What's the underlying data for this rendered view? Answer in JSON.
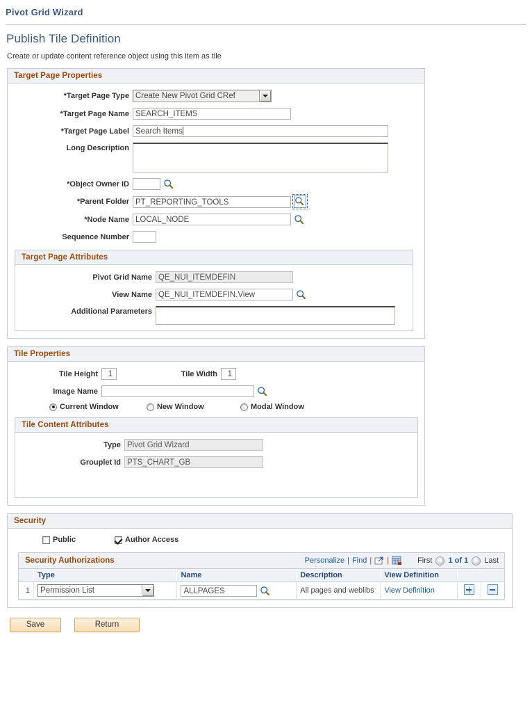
{
  "wizard": {
    "title": "Pivot Grid Wizard"
  },
  "page": {
    "title": "Publish Tile Definition",
    "subtitle": "Create or update content reference object using this item as tile"
  },
  "target_page_properties": {
    "header": "Target Page Properties",
    "fields": {
      "target_page_type": {
        "label": "*Target Page Type",
        "value": "Create New Pivot Grid CRef",
        "icon": "chevron-down-icon"
      },
      "target_page_name": {
        "label": "*Target Page Name",
        "value": "SEARCH_ITEMS"
      },
      "target_page_label": {
        "label": "*Target Page Label",
        "value": "Search Items"
      },
      "long_description": {
        "label": "Long Description",
        "value": ""
      },
      "object_owner_id": {
        "label": "*Object Owner ID",
        "value": "",
        "icon": "lookup-magnifier-icon"
      },
      "parent_folder": {
        "label": "*Parent Folder",
        "value": "PT_REPORTING_TOOLS",
        "icon": "lookup-magnifier-icon"
      },
      "node_name": {
        "label": "*Node Name",
        "value": "LOCAL_NODE",
        "icon": "lookup-magnifier-icon"
      },
      "sequence_number": {
        "label": "Sequence Number",
        "value": ""
      }
    }
  },
  "target_page_attributes": {
    "header": "Target Page Attributes",
    "fields": {
      "pivot_grid_name": {
        "label": "Pivot Grid Name",
        "value": "QE_NUI_ITEMDEFIN"
      },
      "view_name": {
        "label": "View Name",
        "value": "QE_NUI_ITEMDEFIN.View",
        "icon": "lookup-magnifier-icon"
      },
      "additional_parameters": {
        "label": "Additional Parameters",
        "value": ""
      }
    }
  },
  "tile_properties": {
    "header": "Tile Properties",
    "fields": {
      "tile_height": {
        "label": "Tile Height",
        "value": "1"
      },
      "tile_width": {
        "label": "Tile Width",
        "value": "1"
      },
      "image_name": {
        "label": "Image Name",
        "value": "",
        "icon": "lookup-magnifier-icon"
      }
    },
    "window_options": [
      {
        "label": "Current Window",
        "selected": true
      },
      {
        "label": "New Window",
        "selected": false
      },
      {
        "label": "Modal Window",
        "selected": false
      }
    ]
  },
  "tile_content_attributes": {
    "header": "Tile Content Attributes",
    "fields": {
      "type": {
        "label": "Type",
        "value": "Pivot Grid Wizard"
      },
      "grouplet_id": {
        "label": "Grouplet Id",
        "value": "PTS_CHART_GB"
      }
    }
  },
  "security": {
    "header": "Security",
    "checkboxes": [
      {
        "label": "Public",
        "checked": false
      },
      {
        "label": "Author Access",
        "checked": true
      }
    ],
    "grid": {
      "title": "Security Authorizations",
      "toolbar": {
        "personalize": "Personalize",
        "find": "Find",
        "separator": "|",
        "expand_icon": "expand-window-icon",
        "download_icon": "download-spreadsheet-icon"
      },
      "nav": {
        "first": "First",
        "counter": "1 of 1",
        "last": "Last",
        "prev_icon": "previous-arrow-icon",
        "next_icon": "next-arrow-icon"
      },
      "columns": [
        "Type",
        "Name",
        "Description",
        "View Definition",
        "",
        ""
      ],
      "rows": [
        {
          "num": "1",
          "type": "Permission List",
          "name": "ALLPAGES",
          "description": "All pages and weblibs",
          "view_definition": "View Definition",
          "add_icon": "add-row-icon",
          "delete_icon": "delete-row-icon"
        }
      ]
    }
  },
  "footer": {
    "save_label": "Save",
    "return_label": "Return"
  },
  "colors": {
    "title_blue": "#3D5A80",
    "section_brown": "#9A4A0C",
    "link_blue": "#1F5C99",
    "panel_bg": "#eef1f6",
    "button_peach": "#f8dcb4"
  }
}
